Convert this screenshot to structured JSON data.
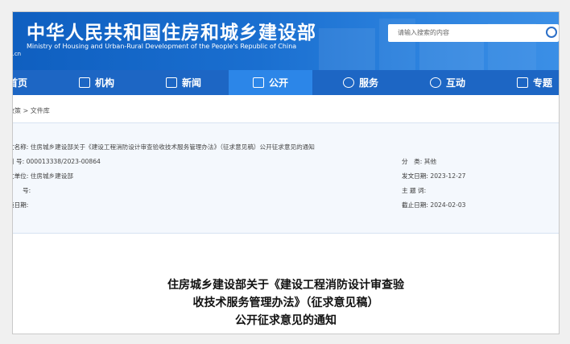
{
  "header": {
    "title_cn": "中华人民共和国住房和城乡建设部",
    "title_en": "Ministry of Housing and Urban-Rural Development of the People's Republic of China",
    "site_url_fragment": "v.cn",
    "search_placeholder": "请输入搜索的内容",
    "search_icon": "search-icon"
  },
  "nav": {
    "items": [
      {
        "label": "首页",
        "icon": "home-icon"
      },
      {
        "label": "机构",
        "icon": "building-icon"
      },
      {
        "label": "新闻",
        "icon": "news-icon"
      },
      {
        "label": "公开",
        "icon": "open-icon",
        "active": true
      },
      {
        "label": "服务",
        "icon": "user-service-icon"
      },
      {
        "label": "互动",
        "icon": "interaction-icon"
      },
      {
        "label": "专题",
        "icon": "star-icon"
      }
    ]
  },
  "breadcrumb": "政策 > 文件库",
  "info": {
    "doc_name_label": "文名称:",
    "doc_name_value": "住房城乡建设部关于《建设工程消防设计审查验收技术服务管理办法》（征求意见稿）公开征求意见的通知",
    "index_label": "引 号:",
    "index_value": "000013338/2023-00864",
    "issuer_label": "文单位:",
    "issuer_value": "住房城乡建设部",
    "docno_label": "号:",
    "docno_value": "",
    "impl_label": "施日期:",
    "impl_value": "",
    "category_label": "分　类:",
    "category_value": "其他",
    "issue_date_label": "发文日期:",
    "issue_date_value": "2023-12-27",
    "keywords_label": "主 题 词:",
    "keywords_value": "",
    "deadline_label": "截止日期:",
    "deadline_value": "2024-02-03"
  },
  "document": {
    "title_line1": "住房城乡建设部关于《建设工程消防设计审查验",
    "title_line2": "收技术服务管理办法》（征求意见稿）",
    "title_line3": "公开征求意见的通知"
  }
}
